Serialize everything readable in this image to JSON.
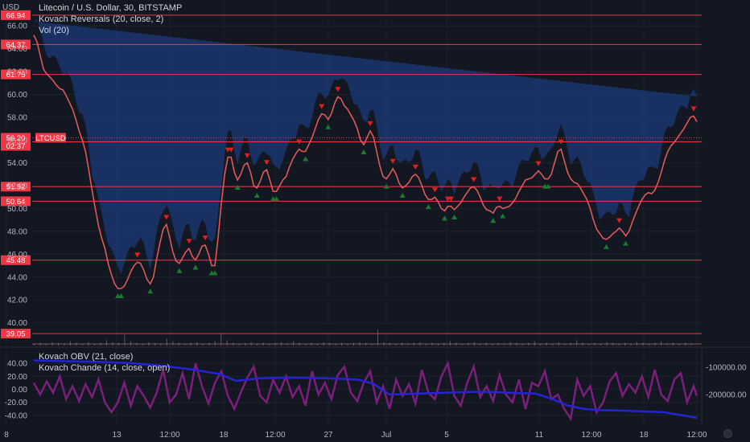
{
  "header": {
    "currency": "USD",
    "legends": [
      "Litecoin / U.S. Dollar, 30, BITSTAMP",
      "Kovach Reversals (20, close, 2)",
      "Vol (20)"
    ],
    "lower_legends": [
      "Kovach OBV (21, close)",
      "Kovach Chande (14, close, open)"
    ]
  },
  "colors": {
    "background": "#131722",
    "grid": "#1e222d",
    "axis_text": "#b2b5be",
    "price_line": "#ef5350",
    "level_line": "#f23645",
    "band": "#1c3a7a",
    "up_marker": "#1b7a2e",
    "down_marker": "#e02020",
    "obv_line": "#2424d6",
    "chande_line": "#7b1f7b",
    "volume": "#b0a8a8"
  },
  "chart_data": [
    {
      "type": "line",
      "title": "Litecoin / U.S. Dollar, 30, BITSTAMP",
      "ylabel": "USD",
      "ylim": [
        38,
        67
      ],
      "y_ticks": [
        "40.00",
        "42.00",
        "44.00",
        "46.00",
        "48.00",
        "50.00",
        "52.00",
        "54.00",
        "56.00",
        "58.00",
        "60.00",
        "62.00",
        "64.00",
        "66.00"
      ],
      "x_tick_labels": [
        "8",
        "13",
        "12:00",
        "18",
        "12:00",
        "27",
        "Jul",
        "5",
        "11",
        "12:00",
        "18",
        "12:00"
      ],
      "x": [
        0,
        4,
        8,
        12,
        16,
        20,
        24,
        28,
        32,
        36,
        40,
        44,
        48,
        52,
        56,
        60,
        64,
        68,
        72,
        76,
        80,
        84,
        88,
        92,
        96,
        100,
        104,
        108,
        112,
        116,
        120,
        124,
        128,
        132,
        136,
        140,
        144,
        148,
        152,
        156,
        160,
        164,
        168,
        172,
        176,
        180,
        184,
        188,
        192,
        196,
        200,
        204,
        208,
        212,
        216,
        220,
        224,
        228,
        232,
        236,
        240,
        244,
        248,
        252,
        256,
        260,
        264,
        268,
        272,
        276,
        280,
        284,
        288,
        292,
        296,
        300,
        304,
        308,
        312,
        316,
        320,
        324,
        328,
        332,
        336,
        340,
        344,
        348,
        352,
        356,
        360,
        364,
        368,
        372,
        376,
        380,
        384,
        388,
        392,
        396,
        400,
        404,
        408,
        412,
        416,
        420,
        424,
        428,
        432,
        436,
        440,
        444,
        448,
        452,
        456,
        460,
        464,
        468,
        472,
        476,
        480,
        484,
        488,
        492,
        496,
        500,
        504,
        508,
        512,
        516,
        520,
        524,
        528,
        532,
        536,
        540,
        544,
        548,
        552,
        556,
        560,
        564,
        568,
        572,
        576,
        580,
        584,
        588,
        592,
        596,
        600,
        604,
        608,
        612,
        616,
        620,
        624,
        628,
        632,
        636,
        640,
        644,
        648,
        652,
        656,
        660,
        664,
        668,
        672,
        676,
        680,
        684,
        688,
        692,
        696,
        700,
        704,
        708,
        712,
        716,
        720,
        724,
        728,
        732,
        736,
        740,
        744,
        748,
        752,
        756,
        760,
        764,
        768,
        772,
        776,
        780,
        784,
        788,
        792,
        796,
        800,
        804,
        808,
        812,
        816,
        820
      ],
      "series": [
        {
          "values": [
            65.2,
            64.6,
            63.4,
            62.2,
            61.8,
            61.5,
            61.2,
            60.8,
            60.5,
            60.4,
            59.9,
            59.3,
            58.7,
            57.8,
            56.8,
            56.0,
            55.0,
            53.4,
            51.6,
            50.0,
            48.5,
            47.4,
            46.5,
            45.2,
            44.2,
            43.4,
            43.0,
            43.0,
            43.2,
            43.8,
            44.5,
            45.0,
            45.3,
            45.2,
            44.6,
            43.8,
            43.4,
            44.0,
            45.6,
            47.0,
            48.2,
            48.6,
            47.5,
            46.2,
            45.4,
            45.2,
            45.7,
            46.2,
            46.5,
            45.8,
            45.5,
            46.0,
            46.7,
            46.8,
            46.0,
            45.0,
            45.0,
            47.5,
            50.5,
            53.0,
            54.5,
            54.5,
            53.2,
            52.5,
            53.0,
            53.8,
            54.0,
            53.2,
            52.0,
            51.8,
            52.4,
            53.2,
            53.4,
            52.5,
            51.5,
            51.5,
            52.0,
            52.5,
            52.8,
            53.6,
            54.3,
            54.8,
            55.2,
            55.0,
            55.0,
            55.6,
            56.2,
            57.0,
            57.8,
            58.3,
            58.2,
            57.8,
            58.3,
            59.2,
            59.8,
            59.6,
            59.0,
            58.7,
            58.2,
            57.7,
            57.0,
            56.0,
            55.6,
            56.2,
            56.8,
            56.3,
            55.0,
            53.7,
            52.8,
            52.6,
            53.0,
            53.5,
            53.0,
            52.2,
            51.8,
            52.0,
            52.3,
            52.8,
            53.0,
            52.7,
            52.0,
            51.2,
            50.8,
            50.8,
            51.0,
            50.6,
            50.0,
            49.8,
            50.2,
            50.2,
            49.9,
            50.2,
            50.5,
            51.0,
            51.4,
            51.8,
            51.9,
            51.6,
            51.0,
            50.3,
            49.9,
            49.8,
            49.6,
            50.1,
            50.2,
            50.0,
            50.1,
            50.2,
            50.5,
            50.9,
            51.5,
            52.0,
            52.5,
            52.6,
            52.7,
            53.0,
            53.3,
            53.0,
            52.6,
            52.6,
            53.0,
            54.0,
            55.0,
            55.2,
            54.2,
            53.2,
            52.6,
            52.3,
            52.2,
            51.8,
            51.3,
            50.8,
            50.0,
            49.0,
            48.2,
            47.8,
            47.4,
            47.3,
            47.5,
            47.8,
            48.0,
            48.3,
            48.0,
            47.6,
            48.0,
            48.8,
            49.5,
            50.2,
            50.8,
            51.2,
            51.4,
            51.3,
            51.6,
            52.3,
            53.2,
            54.2,
            55.0,
            55.5,
            55.8,
            56.2,
            56.6,
            57.0,
            57.5,
            58.0,
            58.1,
            57.6,
            57.2,
            57.6,
            58.4,
            59.0,
            59.2,
            58.3,
            57.5,
            57.2,
            60.0,
            60.5,
            58.5,
            57.0,
            56.2
          ]
        }
      ],
      "horizontal_levels": [
        "66.94",
        "64.37",
        "61.75",
        "55.84",
        "51.92",
        "50.64",
        "45.48",
        "39.05"
      ],
      "current_price": {
        "label": "56.20",
        "symbol": "LTCUSD",
        "countdown": "02:37"
      }
    },
    {
      "type": "line",
      "title": "Kovach OBV (21, close)",
      "ylim": [
        -300000,
        -50000
      ],
      "y_ticks": [
        "-100000.00",
        "-200000.00"
      ],
      "x": [
        0,
        40,
        80,
        120,
        160,
        200,
        230,
        250,
        280,
        320,
        360,
        400,
        420,
        440,
        460,
        480,
        500,
        520,
        540,
        560,
        580,
        600,
        620,
        640,
        660,
        680,
        700,
        720,
        740,
        760,
        780,
        800,
        820
      ],
      "series": [
        {
          "name": "Kovach OBV (21, close)",
          "values": [
            -75000,
            -78000,
            -80000,
            -85000,
            -95000,
            -110000,
            -125000,
            -150000,
            -140000,
            -138000,
            -140000,
            -145000,
            -160000,
            -200000,
            -198000,
            -196000,
            -194000,
            -192000,
            -190000,
            -190000,
            -192000,
            -195000,
            -196000,
            -215000,
            -240000,
            -252000,
            -257000,
            -258000,
            -260000,
            -262000,
            -265000,
            -275000,
            -285000
          ]
        }
      ]
    },
    {
      "type": "line",
      "title": "Kovach Chande (14, close, open)",
      "ylim": [
        -50,
        55
      ],
      "y_ticks": [
        "40.00",
        "20.00",
        "0.00",
        "-20.00",
        "-40.00"
      ],
      "x": [
        0,
        8,
        16,
        24,
        32,
        40,
        48,
        56,
        64,
        72,
        80,
        88,
        96,
        104,
        112,
        120,
        128,
        136,
        144,
        152,
        160,
        168,
        176,
        184,
        192,
        200,
        208,
        216,
        224,
        232,
        240,
        248,
        256,
        264,
        272,
        280,
        288,
        296,
        304,
        312,
        320,
        328,
        336,
        344,
        352,
        360,
        368,
        376,
        384,
        392,
        400,
        408,
        416,
        424,
        432,
        440,
        448,
        456,
        464,
        472,
        480,
        488,
        496,
        504,
        512,
        520,
        528,
        536,
        544,
        552,
        560,
        568,
        576,
        584,
        592,
        600,
        608,
        616,
        624,
        632,
        640,
        648,
        656,
        664,
        672,
        680,
        688,
        696,
        704,
        712,
        720,
        728,
        736,
        744,
        752,
        760,
        768,
        776,
        784,
        792,
        800,
        808,
        816,
        820
      ],
      "series": [
        {
          "name": "Kovach Chande (14, close, open)",
          "values": [
            10,
            -8,
            12,
            -5,
            20,
            -15,
            5,
            -18,
            8,
            -12,
            15,
            -20,
            -35,
            -20,
            10,
            -25,
            5,
            -10,
            -28,
            -5,
            30,
            -20,
            -8,
            25,
            -15,
            40,
            5,
            -22,
            10,
            28,
            -10,
            -30,
            -5,
            18,
            35,
            -10,
            -20,
            15,
            -5,
            20,
            -12,
            5,
            -25,
            28,
            -8,
            10,
            -15,
            22,
            35,
            -5,
            -18,
            10,
            28,
            -20,
            5,
            -30,
            15,
            -10,
            8,
            -22,
            30,
            -5,
            -15,
            20,
            40,
            -10,
            -25,
            10,
            35,
            -12,
            5,
            -18,
            22,
            -8,
            -20,
            15,
            -30,
            10,
            5,
            28,
            -15,
            -8,
            -30,
            -45,
            15,
            -10,
            5,
            -35,
            -20,
            12,
            25,
            -10,
            8,
            -5,
            20,
            -12,
            30,
            -8,
            -18,
            15,
            25,
            -20,
            5,
            -10
          ]
        }
      ]
    },
    {
      "type": "bar",
      "title": "Vol (20)",
      "values": [
        2,
        3,
        2,
        4,
        3,
        2,
        5,
        3,
        2,
        4,
        2,
        3,
        6,
        4,
        3,
        12,
        5,
        3,
        2,
        4,
        3,
        2,
        8,
        5,
        3,
        2,
        3,
        4,
        2,
        3,
        5,
        14,
        6,
        3,
        2,
        3,
        4,
        2,
        3,
        2,
        3,
        4,
        2,
        5,
        3,
        2,
        3,
        2,
        4,
        3,
        2,
        3,
        2,
        3,
        4,
        3,
        2,
        18,
        4,
        3,
        2,
        3,
        2,
        3,
        4,
        2,
        3,
        2,
        3,
        5,
        3,
        2,
        3,
        4,
        2,
        3,
        2,
        3,
        2,
        4,
        3,
        2,
        3,
        5,
        2,
        3,
        2,
        4,
        2,
        3,
        6,
        3,
        2,
        3,
        2,
        4,
        3,
        2,
        3,
        2,
        4,
        3,
        2,
        3,
        5,
        2,
        3,
        2,
        3,
        2
      ]
    }
  ]
}
